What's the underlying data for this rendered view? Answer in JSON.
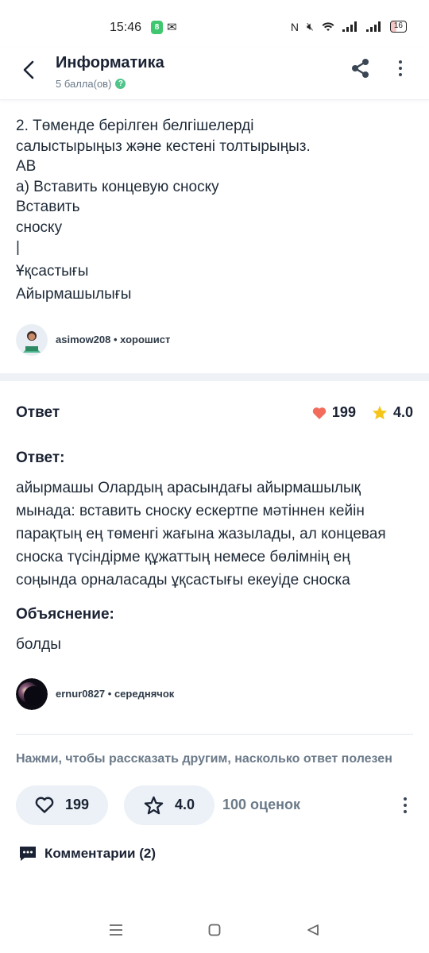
{
  "status_bar": {
    "time": "15:46",
    "app_badge": "8",
    "battery": "16"
  },
  "header": {
    "title": "Информатика",
    "points": "5 балла(ов)",
    "help": "?"
  },
  "question": {
    "lines": [
      "2. Төменде берілген белгішелерді",
      "салыстырыңыз және кестені толтырыңыз.",
      "АВ",
      "а) Вставить концевую сноску",
      "Вставить",
      "сноску",
      "|",
      "Ұқсастығы",
      "Айырмашылығы"
    ],
    "author": {
      "name": "asimow208",
      "rank": "хорошист"
    }
  },
  "answer": {
    "label": "Ответ",
    "likes": "199",
    "rating": "4.0",
    "answer_title": "Ответ:",
    "answer_text": "айырмашы Олардың арасындағы айырмашылық мынада: вставить сноску ескертпе мәтіннен кейін парақтың ең төменгі жағына жазылады, ал концевая сноска түсіндірме құжаттың немесе бөлімнің ең соңында орналасады ұқсастығы екеуіде сноска",
    "explain_title": "Объяснение:",
    "explain_text": "болды",
    "author": {
      "name": "ernur0827",
      "rank": "середнячок"
    }
  },
  "feedback": {
    "prompt": "Нажми, чтобы рассказать другим, насколько ответ полезен",
    "likes": "199",
    "rating": "4.0",
    "ratings_count": "100 оценок"
  },
  "comments": {
    "label": "Комментарии (2)"
  },
  "colors": {
    "heart": "#f26b5b",
    "star": "#f5c518",
    "pill_bg": "#ebf1f7",
    "muted": "#6b7a89",
    "help_green": "#4fc48b"
  },
  "icons": [
    "back-arrow-icon",
    "share-icon",
    "more-vertical-icon",
    "heart-icon",
    "star-icon",
    "comment-icon",
    "menu-icon",
    "home-icon",
    "back-triangle-icon"
  ]
}
